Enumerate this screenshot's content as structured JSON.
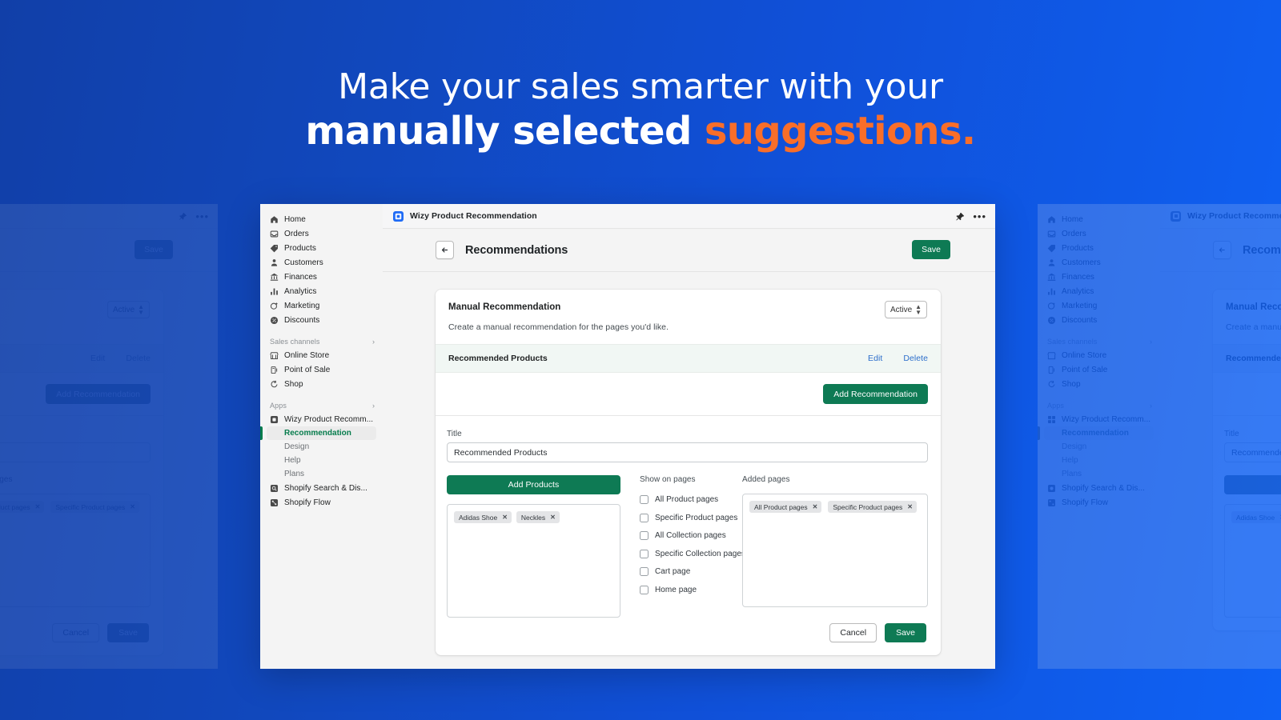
{
  "hero": {
    "line1": "Make your sales smarter with your",
    "line2_white": "manually selected ",
    "line2_orange": "suggestions.",
    "bg_gradient_from": "#113fa8",
    "bg_gradient_to": "#0f62f5",
    "accent_orange": "#f96e29"
  },
  "app": {
    "title": "Wizy Product Recommendation",
    "icon": "app-tile-icon",
    "pin_icon": "pin-icon",
    "more_icon": "more-horizontal-icon"
  },
  "sidebar": {
    "primary": [
      {
        "label": "Home",
        "icon": "home-icon"
      },
      {
        "label": "Orders",
        "icon": "orders-icon"
      },
      {
        "label": "Products",
        "icon": "tag-icon"
      },
      {
        "label": "Customers",
        "icon": "person-icon"
      },
      {
        "label": "Finances",
        "icon": "bank-icon"
      },
      {
        "label": "Analytics",
        "icon": "bar-chart-icon"
      },
      {
        "label": "Marketing",
        "icon": "megaphone-icon"
      },
      {
        "label": "Discounts",
        "icon": "discount-icon"
      }
    ],
    "sales_channels": {
      "title": "Sales channels",
      "chevron": "›",
      "items": [
        {
          "label": "Online Store",
          "icon": "storefront-icon"
        },
        {
          "label": "Point of Sale",
          "icon": "pos-icon"
        },
        {
          "label": "Shop",
          "icon": "shop-bag-icon"
        }
      ]
    },
    "apps": {
      "title": "Apps",
      "chevron": "›",
      "items": [
        {
          "label": "Wizy Product Recomm...",
          "icon": "app-tile-icon"
        }
      ],
      "sub_items": [
        {
          "label": "Recommendation",
          "active": true
        },
        {
          "label": "Design",
          "active": false
        },
        {
          "label": "Help",
          "active": false
        },
        {
          "label": "Plans",
          "active": false
        }
      ],
      "more_apps": [
        {
          "label": "Shopify Search & Dis...",
          "icon": "app-tile-icon"
        },
        {
          "label": "Shopify Flow",
          "icon": "app-tile-icon"
        }
      ]
    }
  },
  "page": {
    "back_icon": "arrow-left-icon",
    "title": "Recommendations",
    "save_label": "Save"
  },
  "card": {
    "title": "Manual Recommendation",
    "subtitle": "Create a manual recommendation for the pages you'd like.",
    "status_value": "Active",
    "status_stepper": "stepper-icon",
    "row_label": "Recommended Products",
    "edit_label": "Edit",
    "delete_label": "Delete",
    "add_recommendation_label": "Add Recommendation"
  },
  "form": {
    "title_label": "Title",
    "title_value": "Recommended Products",
    "title_placeholder": "Title",
    "add_products_label": "Add Products",
    "product_tags": [
      {
        "label": "Adidas Shoe",
        "remove": "✕"
      },
      {
        "label": "Neckles",
        "remove": "✕"
      }
    ],
    "show_on_pages_label": "Show on pages",
    "checkboxes": [
      {
        "label": "All Product pages",
        "checked": false
      },
      {
        "label": "Specific Product pages",
        "checked": false
      },
      {
        "label": "All Collection pages",
        "checked": false
      },
      {
        "label": "Specific Collection pages",
        "checked": false
      },
      {
        "label": "Cart page",
        "checked": false
      },
      {
        "label": "Home page",
        "checked": false
      }
    ],
    "added_pages_label": "Added pages",
    "added_tags": [
      {
        "label": "All Product pages",
        "remove": "✕"
      },
      {
        "label": "Specific Product pages",
        "remove": "✕"
      }
    ],
    "cancel_label": "Cancel",
    "save_label": "Save"
  },
  "colors": {
    "green": "#0e7a54",
    "link_blue": "#2c6ecb",
    "active_green": "#067c4c"
  }
}
